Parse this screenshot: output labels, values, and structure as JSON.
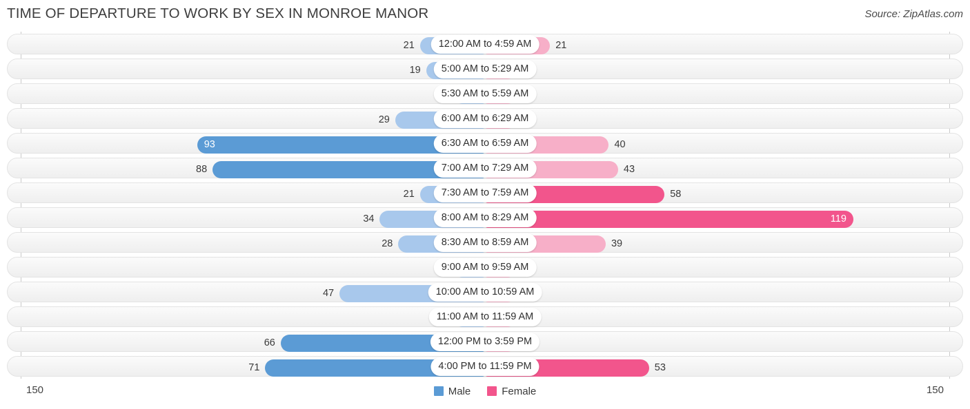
{
  "header": {
    "title": "TIME OF DEPARTURE TO WORK BY SEX IN MONROE MANOR",
    "source": "Source: ZipAtlas.com"
  },
  "axis": {
    "left_label": "150",
    "right_label": "150"
  },
  "legend": [
    {
      "label": "Male",
      "color": "#5b9bd5"
    },
    {
      "label": "Female",
      "color": "#f2558c"
    }
  ],
  "colors": {
    "male_strong": "#5b9bd5",
    "male_light": "#a8c8ec",
    "female_strong": "#f2558c",
    "female_light": "#f7afc8",
    "track_border": "#e3e3e3",
    "axis": "#c9c9c9"
  },
  "chart_data": {
    "type": "bar",
    "orientation": "horizontal",
    "style": "diverging-bidirectional",
    "title": "TIME OF DEPARTURE TO WORK BY SEX IN MONROE MANOR",
    "xlabel": "",
    "ylabel": "",
    "xlim": [
      -150,
      150
    ],
    "axis_max": 150,
    "grid": false,
    "legend_position": "bottom-center",
    "categories": [
      "12:00 AM to 4:59 AM",
      "5:00 AM to 5:29 AM",
      "5:30 AM to 5:59 AM",
      "6:00 AM to 6:29 AM",
      "6:30 AM to 6:59 AM",
      "7:00 AM to 7:29 AM",
      "7:30 AM to 7:59 AM",
      "8:00 AM to 8:29 AM",
      "8:30 AM to 8:59 AM",
      "9:00 AM to 9:59 AM",
      "10:00 AM to 10:59 AM",
      "11:00 AM to 11:59 AM",
      "12:00 PM to 3:59 PM",
      "4:00 PM to 11:59 PM"
    ],
    "series": [
      {
        "name": "Male",
        "color": "#5b9bd5",
        "side": "left",
        "values": [
          21,
          19,
          0,
          29,
          93,
          88,
          21,
          34,
          28,
          0,
          47,
          0,
          66,
          71
        ]
      },
      {
        "name": "Female",
        "color": "#f2558c",
        "side": "right",
        "values": [
          21,
          0,
          0,
          0,
          40,
          43,
          58,
          119,
          39,
          0,
          0,
          0,
          0,
          53
        ]
      }
    ]
  }
}
